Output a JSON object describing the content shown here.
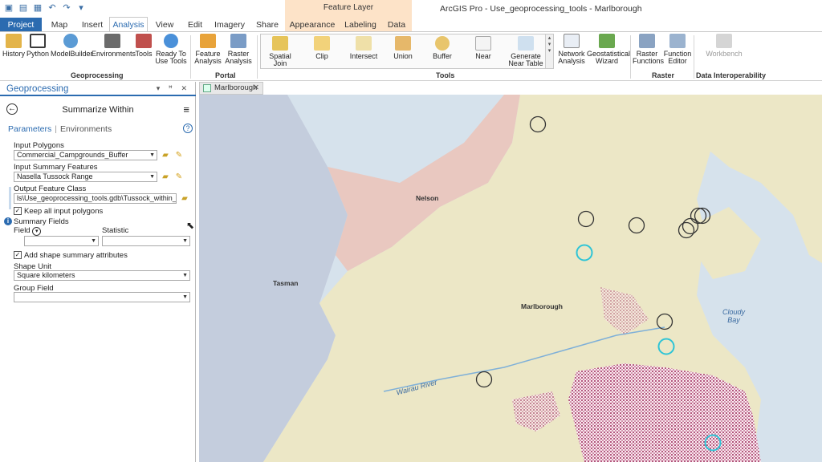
{
  "app": {
    "title": "ArcGIS Pro - Use_geoprocessing_tools - Marlborough",
    "contextual_header": "Feature Layer"
  },
  "tabs": [
    "Project",
    "Map",
    "Insert",
    "Analysis",
    "View",
    "Edit",
    "Imagery",
    "Share",
    "Appearance",
    "Labeling",
    "Data"
  ],
  "ribbon": {
    "geoprocessing": {
      "label": "Geoprocessing",
      "buttons": [
        "History",
        "Python",
        "ModelBuilder",
        "Environments",
        "Tools",
        "Ready To\nUse Tools"
      ]
    },
    "portal": {
      "label": "Portal",
      "buttons": [
        "Feature\nAnalysis",
        "Raster\nAnalysis"
      ]
    },
    "tools": {
      "label": "Tools",
      "buttons": [
        "Spatial\nJoin",
        "Clip",
        "Intersect",
        "Union",
        "Buffer",
        "Near",
        "Generate\nNear Table"
      ]
    },
    "network": {
      "buttons": [
        "Network\nAnalysis",
        "Geostatistical\nWizard"
      ]
    },
    "raster": {
      "label": "Raster",
      "buttons": [
        "Raster\nFunctions",
        "Function\nEditor"
      ]
    },
    "interop": {
      "label": "Data Interoperability",
      "buttons": [
        "Workbench"
      ]
    }
  },
  "panel": {
    "title": "Geoprocessing",
    "controls": "▾ ꟸ ✕",
    "tool_name": "Summarize Within",
    "subtab_params": "Parameters",
    "subtab_env": "Environments",
    "input_polygons_label": "Input Polygons",
    "input_polygons_value": "Commercial_Campgrounds_Buffer",
    "input_summary_label": "Input Summary Features",
    "input_summary_value": "Nasella Tussock Range",
    "output_label": "Output Feature Class",
    "output_value": "ls\\Use_geoprocessing_tools.gdb\\Tussock_within_Buffers",
    "keep_all_label": "Keep all input polygons",
    "summary_fields_label": "Summary Fields",
    "field_label": "Field",
    "statistic_label": "Statistic",
    "add_shape_label": "Add shape summary attributes",
    "shape_unit_label": "Shape Unit",
    "shape_unit_value": "Square kilometers",
    "group_field_label": "Group Field"
  },
  "map": {
    "tab_label": "Marlborough",
    "regions": [
      "Nelson",
      "Tasman",
      "Marlborough"
    ],
    "water": [
      "Cloudy\nBay",
      "Wairau River"
    ]
  },
  "colors": {
    "accent": "#2b6bb0",
    "nelson_region": "#e9c8c0",
    "tasman_region": "#c4cddd",
    "marlborough_region": "#ece7c6",
    "sea": "#d6e2ec",
    "tussock": "#9c2a5a",
    "buffer_black": "#333333",
    "buffer_cyan": "#2ec4d6"
  }
}
